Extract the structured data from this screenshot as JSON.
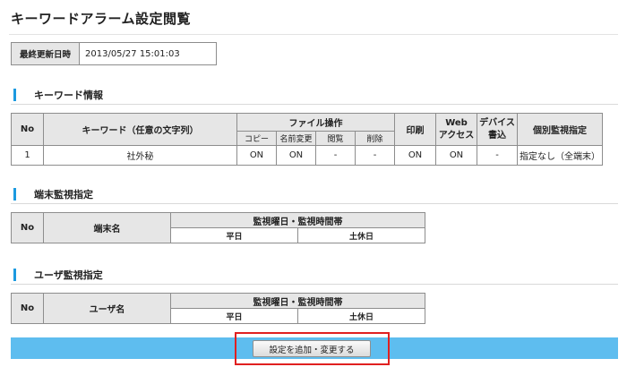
{
  "page": {
    "title": "キーワードアラーム設定閲覧"
  },
  "updated": {
    "label": "最終更新日時",
    "value": "2013/05/27 15:01:03"
  },
  "keyword_section": {
    "title": "キーワード情報",
    "headers": {
      "no": "No",
      "keyword": "キーワード（任意の文字列）",
      "file_ops": "ファイル操作",
      "copy": "コピー",
      "rename": "名前変更",
      "view": "閲覧",
      "delete": "削除",
      "print": "印刷",
      "web_line1": "Web",
      "web_line2": "アクセス",
      "device_line1": "デバイス",
      "device_line2": "書込",
      "individual": "個別監視指定"
    },
    "rows": [
      {
        "no": "1",
        "keyword": "社外秘",
        "copy": "ON",
        "rename": "ON",
        "view": "-",
        "delete": "-",
        "print": "ON",
        "web": "ON",
        "device": "-",
        "individual": "指定なし（全端末）"
      }
    ]
  },
  "terminal_section": {
    "title": "端末監視指定",
    "headers": {
      "no": "No",
      "name": "端末名",
      "schedule": "監視曜日・監視時間帯",
      "weekday": "平日",
      "holiday": "土休日"
    }
  },
  "user_section": {
    "title": "ユーザ監視指定",
    "headers": {
      "no": "No",
      "name": "ユーザ名",
      "schedule": "監視曜日・監視時間帯",
      "weekday": "平日",
      "holiday": "土休日"
    }
  },
  "footer": {
    "button_label": "設定を追加・変更する",
    "highlight_color": "#e02020",
    "bar_color": "#5ebdef"
  },
  "colors": {
    "section_accent": "#1b9ae0",
    "header_bg": "#e6e6e6"
  }
}
